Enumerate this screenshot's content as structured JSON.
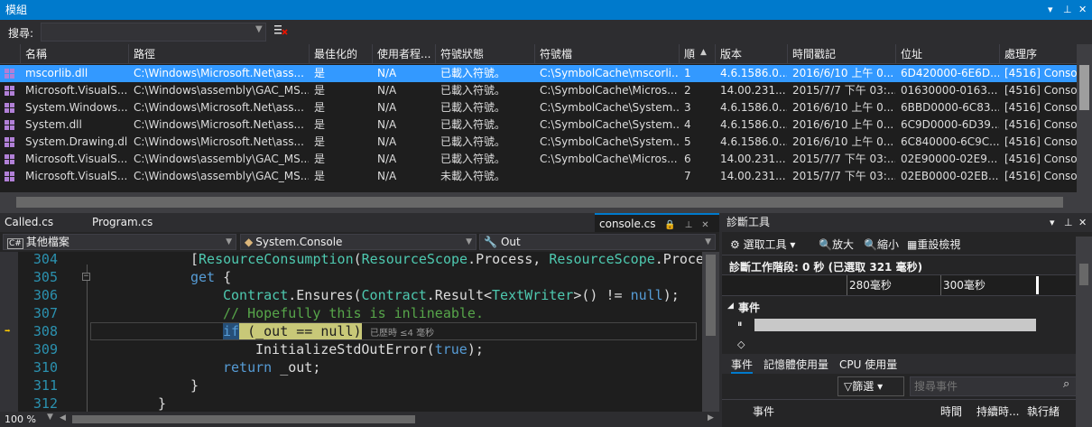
{
  "modules_panel": {
    "title": "模組",
    "search_label": "搜尋:",
    "search_value": "",
    "columns": [
      "名稱",
      "路徑",
      "最佳化的",
      "使用者程...",
      "符號狀態",
      "符號檔",
      "順",
      "版本",
      "時間戳記",
      "位址",
      "處理序"
    ],
    "sort_indicator": "▲",
    "rows": [
      {
        "name": "mscorlib.dll",
        "path": "C:\\Windows\\Microsoft.Net\\ass...",
        "optimized": "是",
        "user_code": "N/A",
        "symbol_status": "已載入符號。",
        "symbol_file": "C:\\SymbolCache\\mscorli...",
        "order": "1",
        "version": "4.6.1586.0...",
        "timestamp": "2016/6/10 上午 0...",
        "address": "6D420000-6E6D...",
        "process": "[4516] Consol"
      },
      {
        "name": "Microsoft.VisualS...",
        "path": "C:\\Windows\\assembly\\GAC_MS...",
        "optimized": "是",
        "user_code": "N/A",
        "symbol_status": "已載入符號。",
        "symbol_file": "C:\\SymbolCache\\Micros...",
        "order": "2",
        "version": "14.00.231...",
        "timestamp": "2015/7/7 下午 03:...",
        "address": "01630000-0163...",
        "process": "[4516] Consol"
      },
      {
        "name": "System.Windows....",
        "path": "C:\\Windows\\Microsoft.Net\\ass...",
        "optimized": "是",
        "user_code": "N/A",
        "symbol_status": "已載入符號。",
        "symbol_file": "C:\\SymbolCache\\System...",
        "order": "3",
        "version": "4.6.1586.0...",
        "timestamp": "2016/6/10 上午 0...",
        "address": "6BBD0000-6C83...",
        "process": "[4516] Consol"
      },
      {
        "name": "System.dll",
        "path": "C:\\Windows\\Microsoft.Net\\ass...",
        "optimized": "是",
        "user_code": "N/A",
        "symbol_status": "已載入符號。",
        "symbol_file": "C:\\SymbolCache\\System...",
        "order": "4",
        "version": "4.6.1586.0...",
        "timestamp": "2016/6/10 上午 0...",
        "address": "6C9D0000-6D39...",
        "process": "[4516] Consol"
      },
      {
        "name": "System.Drawing.dll",
        "path": "C:\\Windows\\Microsoft.Net\\ass...",
        "optimized": "是",
        "user_code": "N/A",
        "symbol_status": "已載入符號。",
        "symbol_file": "C:\\SymbolCache\\System...",
        "order": "5",
        "version": "4.6.1586.0...",
        "timestamp": "2016/6/10 上午 0...",
        "address": "6C840000-6C9C...",
        "process": "[4516] Consol"
      },
      {
        "name": "Microsoft.VisualS...",
        "path": "C:\\Windows\\assembly\\GAC_MS...",
        "optimized": "是",
        "user_code": "N/A",
        "symbol_status": "已載入符號。",
        "symbol_file": "C:\\SymbolCache\\Micros...",
        "order": "6",
        "version": "14.00.231...",
        "timestamp": "2015/7/7 下午 03:...",
        "address": "02E90000-02E9...",
        "process": "[4516] Consol"
      },
      {
        "name": "Microsoft.VisualS...",
        "path": "C:\\Windows\\assembly\\GAC_MS...",
        "optimized": "是",
        "user_code": "N/A",
        "symbol_status": "未載入符號。",
        "symbol_file": "",
        "order": "7",
        "version": "14.00.231...",
        "timestamp": "2015/7/7 下午 03:...",
        "address": "02EB0000-02EB...",
        "process": "[4516] Consol"
      }
    ]
  },
  "editor": {
    "tabs": [
      {
        "label": "Called.cs"
      },
      {
        "label": "Program.cs"
      },
      {
        "label": "console.cs"
      }
    ],
    "nav": {
      "project": "其他檔案",
      "type": "System.Console",
      "member": "Out"
    },
    "zoom": "100 %",
    "elapsed_hint": "已歷時 ≤4 毫秒",
    "lines": [
      {
        "num": "304",
        "text": "[ResourceConsumption(ResourceScope.Process, ResourceScope.Proce"
      },
      {
        "num": "305",
        "text": "get {"
      },
      {
        "num": "306",
        "text": "Contract.Ensures(Contract.Result<TextWriter>() != null);"
      },
      {
        "num": "307",
        "text": "// Hopefully this is inlineable."
      },
      {
        "num": "308",
        "text": "if (_out == null)"
      },
      {
        "num": "309",
        "text": "InitializeStdOutError(true);"
      },
      {
        "num": "310",
        "text": "return _out;"
      },
      {
        "num": "311",
        "text": "}"
      },
      {
        "num": "312",
        "text": "}"
      }
    ]
  },
  "diagnostics": {
    "title": "診斷工具",
    "select_tool": "選取工具",
    "zoom_in": "放大",
    "zoom_out": "縮小",
    "reset_view": "重設檢視",
    "session": "診斷工作階段: 0 秒 (已選取 321 毫秒)",
    "ticks": [
      "280毫秒",
      "300毫秒"
    ],
    "events_label": "事件",
    "tabs": [
      "事件",
      "記憶體使用量",
      "CPU 使用量"
    ],
    "filter_label": "篩選",
    "search_placeholder": "搜尋事件",
    "columns": [
      "事件",
      "時間",
      "持續時...",
      "執行緒"
    ]
  },
  "colors": {
    "accent": "#007acc",
    "selected_row": "#3399ff",
    "keyword": "#569cd6",
    "type": "#4ec9b0",
    "comment": "#57a64a"
  }
}
